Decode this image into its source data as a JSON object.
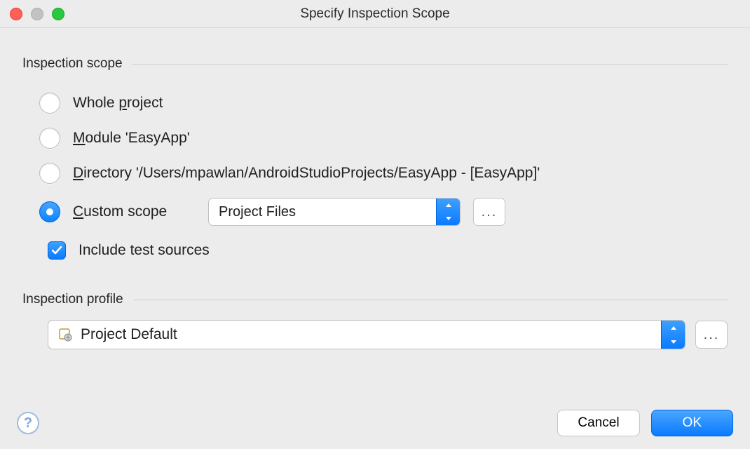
{
  "window": {
    "title": "Specify Inspection Scope"
  },
  "sections": {
    "scope": "Inspection scope",
    "profile": "Inspection profile"
  },
  "scope": {
    "whole_project": "Whole project",
    "module": "Module 'EasyApp'",
    "directory": "Directory '/Users/mpawlan/AndroidStudioProjects/EasyApp - [EasyApp]'",
    "custom": "Custom scope",
    "custom_selected": "Project Files",
    "include_tests": "Include test sources",
    "selected": "custom",
    "include_tests_checked": true
  },
  "profile": {
    "selected": "Project Default"
  },
  "buttons": {
    "cancel": "Cancel",
    "ok": "OK",
    "ellipsis": "...",
    "help": "?"
  }
}
